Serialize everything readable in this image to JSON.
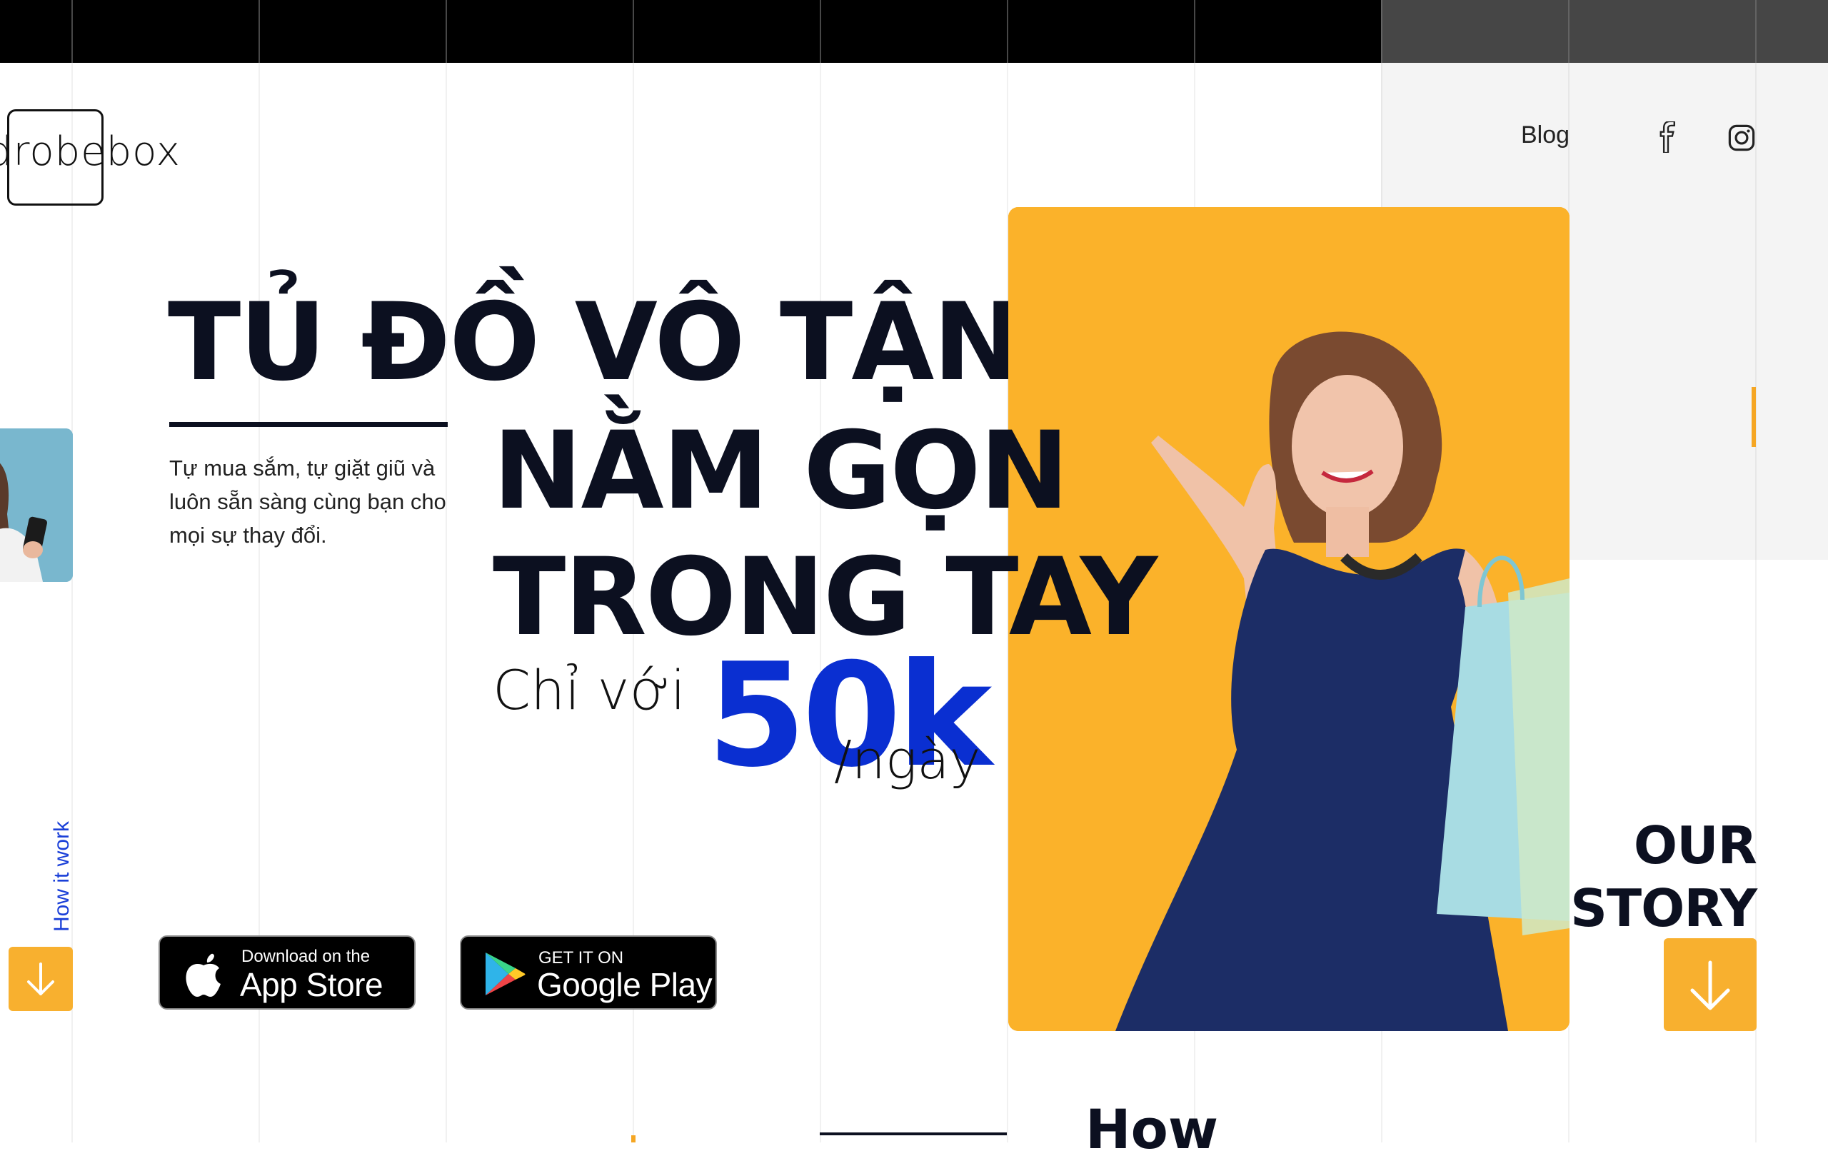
{
  "brand": {
    "logo_text": "drobebox"
  },
  "nav": {
    "blog": "Blog",
    "facebook_icon": "facebook-icon",
    "instagram_icon": "instagram-icon"
  },
  "hero": {
    "line1": "TỦ ĐỒ VÔ TẬN",
    "line2": "NẰM GỌN",
    "line3": "TRONG TAY",
    "subtext": "Tự mua sắm, tự giặt giũ và luôn sẵn sàng cùng bạn cho mọi sự thay đổi.",
    "price_prefix": "Chỉ với",
    "price_value": "50k",
    "price_suffix": "/ngày"
  },
  "side": {
    "how_it_work": "How it work"
  },
  "story": {
    "line1": "OUR",
    "line2": "STORY"
  },
  "badges": {
    "apple_small": "Download on the",
    "apple_big": "App Store",
    "google_small": "GET IT ON",
    "google_big": "Google Play"
  },
  "bottom": {
    "heading_partial": "How"
  },
  "colors": {
    "accent_yellow": "#fbb22a",
    "accent_blue": "#0a2fd1",
    "text_dark": "#0c1020"
  }
}
